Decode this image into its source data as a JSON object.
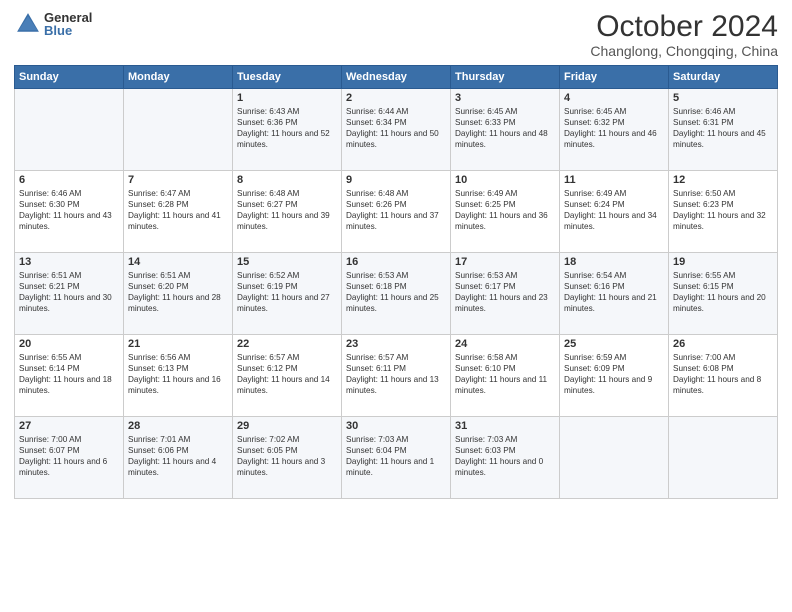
{
  "logo": {
    "general": "General",
    "blue": "Blue"
  },
  "title": "October 2024",
  "subtitle": "Changlong, Chongqing, China",
  "weekdays": [
    "Sunday",
    "Monday",
    "Tuesday",
    "Wednesday",
    "Thursday",
    "Friday",
    "Saturday"
  ],
  "weeks": [
    [
      {
        "day": "",
        "content": ""
      },
      {
        "day": "",
        "content": ""
      },
      {
        "day": "1",
        "content": "Sunrise: 6:43 AM\nSunset: 6:36 PM\nDaylight: 11 hours and 52 minutes."
      },
      {
        "day": "2",
        "content": "Sunrise: 6:44 AM\nSunset: 6:34 PM\nDaylight: 11 hours and 50 minutes."
      },
      {
        "day": "3",
        "content": "Sunrise: 6:45 AM\nSunset: 6:33 PM\nDaylight: 11 hours and 48 minutes."
      },
      {
        "day": "4",
        "content": "Sunrise: 6:45 AM\nSunset: 6:32 PM\nDaylight: 11 hours and 46 minutes."
      },
      {
        "day": "5",
        "content": "Sunrise: 6:46 AM\nSunset: 6:31 PM\nDaylight: 11 hours and 45 minutes."
      }
    ],
    [
      {
        "day": "6",
        "content": "Sunrise: 6:46 AM\nSunset: 6:30 PM\nDaylight: 11 hours and 43 minutes."
      },
      {
        "day": "7",
        "content": "Sunrise: 6:47 AM\nSunset: 6:28 PM\nDaylight: 11 hours and 41 minutes."
      },
      {
        "day": "8",
        "content": "Sunrise: 6:48 AM\nSunset: 6:27 PM\nDaylight: 11 hours and 39 minutes."
      },
      {
        "day": "9",
        "content": "Sunrise: 6:48 AM\nSunset: 6:26 PM\nDaylight: 11 hours and 37 minutes."
      },
      {
        "day": "10",
        "content": "Sunrise: 6:49 AM\nSunset: 6:25 PM\nDaylight: 11 hours and 36 minutes."
      },
      {
        "day": "11",
        "content": "Sunrise: 6:49 AM\nSunset: 6:24 PM\nDaylight: 11 hours and 34 minutes."
      },
      {
        "day": "12",
        "content": "Sunrise: 6:50 AM\nSunset: 6:23 PM\nDaylight: 11 hours and 32 minutes."
      }
    ],
    [
      {
        "day": "13",
        "content": "Sunrise: 6:51 AM\nSunset: 6:21 PM\nDaylight: 11 hours and 30 minutes."
      },
      {
        "day": "14",
        "content": "Sunrise: 6:51 AM\nSunset: 6:20 PM\nDaylight: 11 hours and 28 minutes."
      },
      {
        "day": "15",
        "content": "Sunrise: 6:52 AM\nSunset: 6:19 PM\nDaylight: 11 hours and 27 minutes."
      },
      {
        "day": "16",
        "content": "Sunrise: 6:53 AM\nSunset: 6:18 PM\nDaylight: 11 hours and 25 minutes."
      },
      {
        "day": "17",
        "content": "Sunrise: 6:53 AM\nSunset: 6:17 PM\nDaylight: 11 hours and 23 minutes."
      },
      {
        "day": "18",
        "content": "Sunrise: 6:54 AM\nSunset: 6:16 PM\nDaylight: 11 hours and 21 minutes."
      },
      {
        "day": "19",
        "content": "Sunrise: 6:55 AM\nSunset: 6:15 PM\nDaylight: 11 hours and 20 minutes."
      }
    ],
    [
      {
        "day": "20",
        "content": "Sunrise: 6:55 AM\nSunset: 6:14 PM\nDaylight: 11 hours and 18 minutes."
      },
      {
        "day": "21",
        "content": "Sunrise: 6:56 AM\nSunset: 6:13 PM\nDaylight: 11 hours and 16 minutes."
      },
      {
        "day": "22",
        "content": "Sunrise: 6:57 AM\nSunset: 6:12 PM\nDaylight: 11 hours and 14 minutes."
      },
      {
        "day": "23",
        "content": "Sunrise: 6:57 AM\nSunset: 6:11 PM\nDaylight: 11 hours and 13 minutes."
      },
      {
        "day": "24",
        "content": "Sunrise: 6:58 AM\nSunset: 6:10 PM\nDaylight: 11 hours and 11 minutes."
      },
      {
        "day": "25",
        "content": "Sunrise: 6:59 AM\nSunset: 6:09 PM\nDaylight: 11 hours and 9 minutes."
      },
      {
        "day": "26",
        "content": "Sunrise: 7:00 AM\nSunset: 6:08 PM\nDaylight: 11 hours and 8 minutes."
      }
    ],
    [
      {
        "day": "27",
        "content": "Sunrise: 7:00 AM\nSunset: 6:07 PM\nDaylight: 11 hours and 6 minutes."
      },
      {
        "day": "28",
        "content": "Sunrise: 7:01 AM\nSunset: 6:06 PM\nDaylight: 11 hours and 4 minutes."
      },
      {
        "day": "29",
        "content": "Sunrise: 7:02 AM\nSunset: 6:05 PM\nDaylight: 11 hours and 3 minutes."
      },
      {
        "day": "30",
        "content": "Sunrise: 7:03 AM\nSunset: 6:04 PM\nDaylight: 11 hours and 1 minute."
      },
      {
        "day": "31",
        "content": "Sunrise: 7:03 AM\nSunset: 6:03 PM\nDaylight: 11 hours and 0 minutes."
      },
      {
        "day": "",
        "content": ""
      },
      {
        "day": "",
        "content": ""
      }
    ]
  ]
}
